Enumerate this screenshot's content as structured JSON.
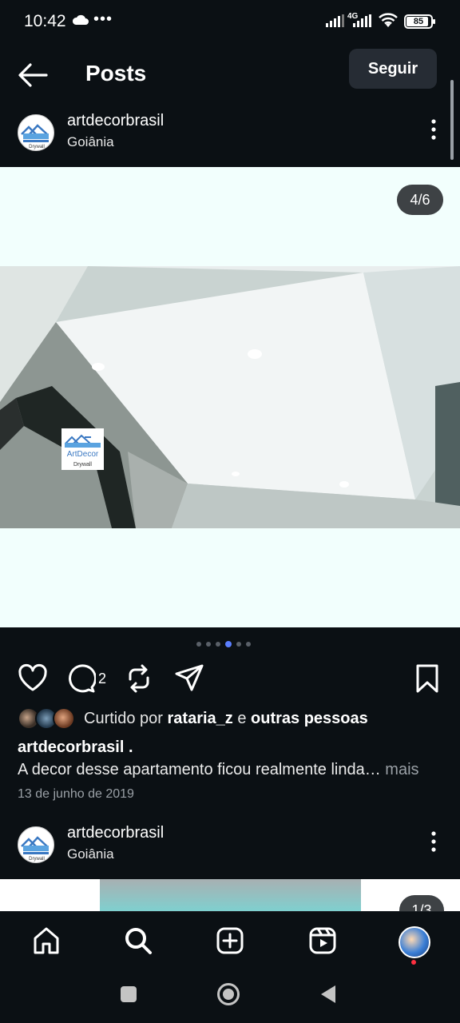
{
  "status_bar": {
    "time": "10:42",
    "more_indicator": "•••",
    "network_type": "4G",
    "battery_level": "85"
  },
  "header": {
    "title": "Posts",
    "follow_label": "Seguir"
  },
  "post": {
    "username": "artdecorbrasil",
    "location": "Goiânia",
    "media_counter": "4/6",
    "logo_text": "ArtDecor",
    "logo_subtext": "Drywall",
    "carousel": {
      "count": 6,
      "active_index": 3
    },
    "comment_count": "2",
    "likes_prefix": "Curtido por",
    "liked_by_user": "rataria_z",
    "likes_connector": "e",
    "likes_others": "outras pessoas",
    "caption_username": "artdecorbrasil .",
    "caption_text": "A decor desse apartamento ficou realmente linda…",
    "caption_more": "mais",
    "date": "13 de junho de 2019"
  },
  "next_post": {
    "username": "artdecorbrasil",
    "location": "Goiânia",
    "media_counter": "1/3"
  },
  "icons": {
    "header": [
      "arrow-left-icon"
    ],
    "actions": [
      "heart-icon",
      "comment-icon",
      "repost-icon",
      "share-icon",
      "bookmark-icon"
    ],
    "bottom_nav": [
      "home-icon",
      "search-icon",
      "create-icon",
      "reels-icon",
      "profile-avatar"
    ],
    "system_nav": [
      "recents-button",
      "home-button",
      "back-button"
    ]
  },
  "colors": {
    "background": "#0b1014",
    "accent_dot": "#5b7fff",
    "notification": "#ff3040",
    "follow_button": "#262c34"
  }
}
